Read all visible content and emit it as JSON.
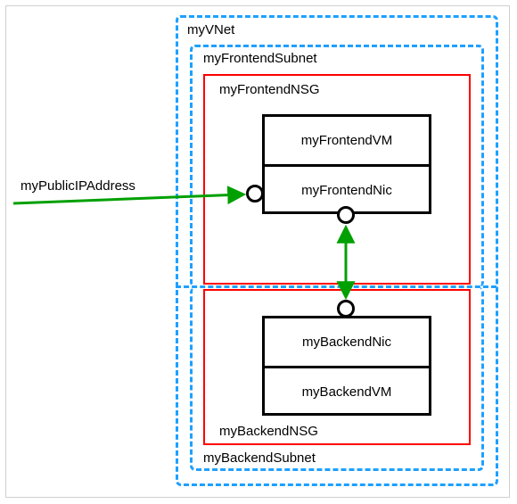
{
  "publicIp": {
    "label": "myPublicIPAddress"
  },
  "vnet": {
    "label": "myVNet"
  },
  "frontendSubnet": {
    "label": "myFrontendSubnet"
  },
  "backendSubnet": {
    "label": "myBackendSubnet"
  },
  "frontendNSG": {
    "label": "myFrontendNSG"
  },
  "backendNSG": {
    "label": "myBackendNSG"
  },
  "frontendVM": {
    "label": "myFrontendVM"
  },
  "frontendNic": {
    "label": "myFrontendNic"
  },
  "backendNic": {
    "label": "myBackendNic"
  },
  "backendVM": {
    "label": "myBackendVM"
  },
  "colors": {
    "azureBlue": "#1ea0ff",
    "nsgRed": "#ff0000",
    "arrowGreen": "#00a000",
    "box": "#000000"
  }
}
